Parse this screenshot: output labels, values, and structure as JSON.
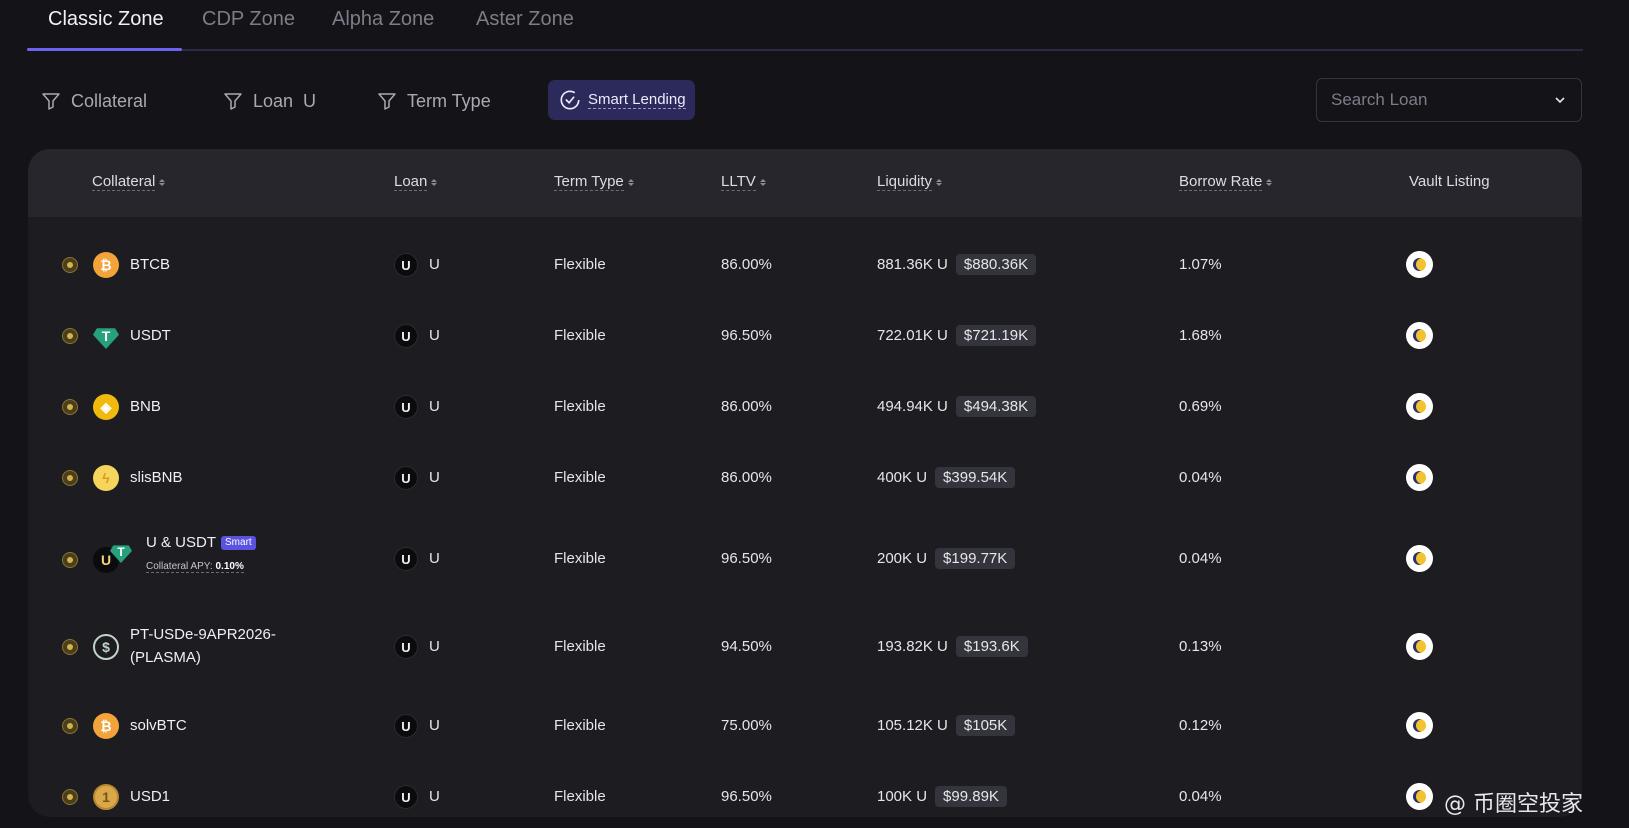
{
  "tabs": [
    {
      "label": "Classic Zone",
      "active": true
    },
    {
      "label": "CDP Zone",
      "active": false
    },
    {
      "label": "Alpha Zone",
      "active": false
    },
    {
      "label": "Aster Zone",
      "active": false
    }
  ],
  "filters": {
    "collateral": "Collateral",
    "loan": "Loan",
    "loan_value": "U",
    "term_type": "Term Type",
    "smart_lending": "Smart Lending"
  },
  "search": {
    "placeholder": "Search Loan"
  },
  "columns": {
    "collateral": "Collateral",
    "loan": "Loan",
    "term_type": "Term Type",
    "lltv": "LLTV",
    "liquidity": "Liquidity",
    "borrow_rate": "Borrow Rate",
    "vault_listing": "Vault Listing"
  },
  "rows": [
    {
      "collateral": "BTCB",
      "icon": "btc-icon",
      "loan": "U",
      "loan_glyph": "U",
      "term": "Flexible",
      "lltv": "86.00%",
      "liquidity": "881.36K U",
      "liquidity_usd": "$880.36K",
      "borrow_rate": "1.07%"
    },
    {
      "collateral": "USDT",
      "icon": "usdt-icon",
      "loan": "U",
      "loan_glyph": "U",
      "term": "Flexible",
      "lltv": "96.50%",
      "liquidity": "722.01K U",
      "liquidity_usd": "$721.19K",
      "borrow_rate": "1.68%"
    },
    {
      "collateral": "BNB",
      "icon": "bnb-icon",
      "loan": "U",
      "loan_glyph": "U",
      "term": "Flexible",
      "lltv": "86.00%",
      "liquidity": "494.94K U",
      "liquidity_usd": "$494.38K",
      "borrow_rate": "0.69%"
    },
    {
      "collateral": "slisBNB",
      "icon": "slisbnb-icon",
      "loan": "U",
      "loan_glyph": "U",
      "term": "Flexible",
      "lltv": "86.00%",
      "liquidity": "400K U",
      "liquidity_usd": "$399.54K",
      "borrow_rate": "0.04%"
    },
    {
      "collateral": "U & USDT",
      "icon": "u-usdt-icon",
      "smart_tag": "Smart",
      "apy_label": "Collateral APY:",
      "apy_value": "0.10%",
      "loan": "U",
      "loan_glyph": "U",
      "term": "Flexible",
      "lltv": "96.50%",
      "liquidity": "200K U",
      "liquidity_usd": "$199.77K",
      "borrow_rate": "0.04%"
    },
    {
      "collateral_line1": "PT-USDe-9APR2026-",
      "collateral_line2": "(PLASMA)",
      "icon": "usde-icon",
      "loan": "U",
      "loan_glyph": "U",
      "term": "Flexible",
      "lltv": "94.50%",
      "liquidity": "193.82K U",
      "liquidity_usd": "$193.6K",
      "borrow_rate": "0.13%"
    },
    {
      "collateral": "solvBTC",
      "icon": "solvbtc-icon",
      "loan": "U",
      "loan_glyph": "U",
      "term": "Flexible",
      "lltv": "75.00%",
      "liquidity": "105.12K U",
      "liquidity_usd": "$105K",
      "borrow_rate": "0.12%"
    },
    {
      "collateral": "USD1",
      "icon": "usd1-icon",
      "loan": "U",
      "loan_glyph": "U",
      "term": "Flexible",
      "lltv": "96.50%",
      "liquidity": "100K U",
      "liquidity_usd": "$99.89K",
      "borrow_rate": "0.04%"
    }
  ],
  "coin_glyphs": {
    "btc": "₿",
    "usdt": "T",
    "bnb": "◈",
    "slis": "ϟ",
    "usde": "$",
    "usd1": "1",
    "u": "U"
  },
  "watermark": "@ 币圈空投家",
  "colors": {
    "accent": "#6b62f0",
    "background": "#131318",
    "table_bg": "#1c1c21",
    "header_bg": "#26262c"
  }
}
